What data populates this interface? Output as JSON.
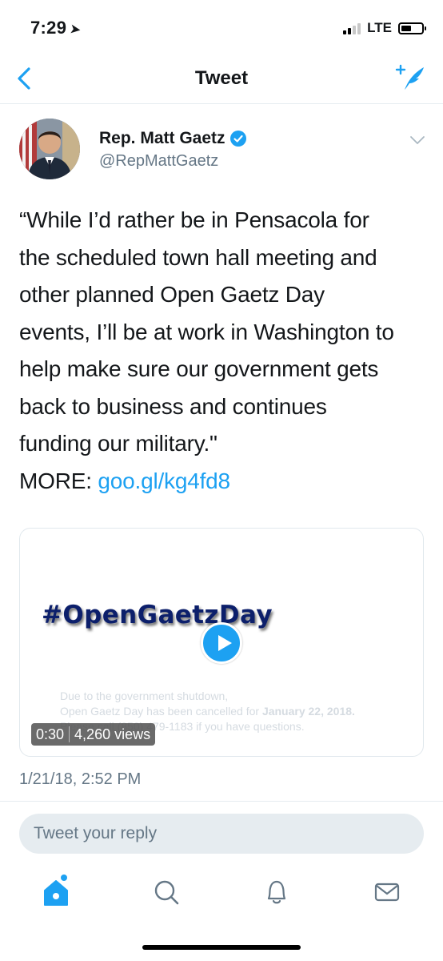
{
  "status": {
    "time": "7:29",
    "network": "LTE"
  },
  "nav": {
    "title": "Tweet"
  },
  "tweet": {
    "author_name": "Rep. Matt Gaetz",
    "handle": "@RepMattGaetz",
    "body_lines": [
      "“While I’d rather be in Pensacola for",
      "the scheduled town hall meeting and",
      "other planned Open Gaetz Day",
      "events, I’ll be at work in Washington to",
      "help make sure our government gets",
      "back to business and continues",
      "funding our military.\""
    ],
    "more_label": "MORE:",
    "more_link": "goo.gl/kg4fd8",
    "timestamp": "1/21/18, 2:52 PM"
  },
  "media": {
    "hashtag": "#OpenGaetzDay",
    "notice_line1": "Due to the government shutdown,",
    "notice_line2_prefix": "Open Gaetz Day has been cancelled for ",
    "notice_line2_bold": "January 22, 2018.",
    "notice_line3": "Please call (850) 479-1183 if you have questions.",
    "duration": "0:30",
    "views": "4,260 views"
  },
  "reply": {
    "placeholder": "Tweet your reply"
  },
  "tabs": [
    {
      "icon": "home-icon"
    },
    {
      "icon": "search-icon"
    },
    {
      "icon": "bell-icon"
    },
    {
      "icon": "mail-icon"
    }
  ],
  "colors": {
    "accent": "#1da1f2",
    "text": "#14171a",
    "secondary": "#657786"
  }
}
